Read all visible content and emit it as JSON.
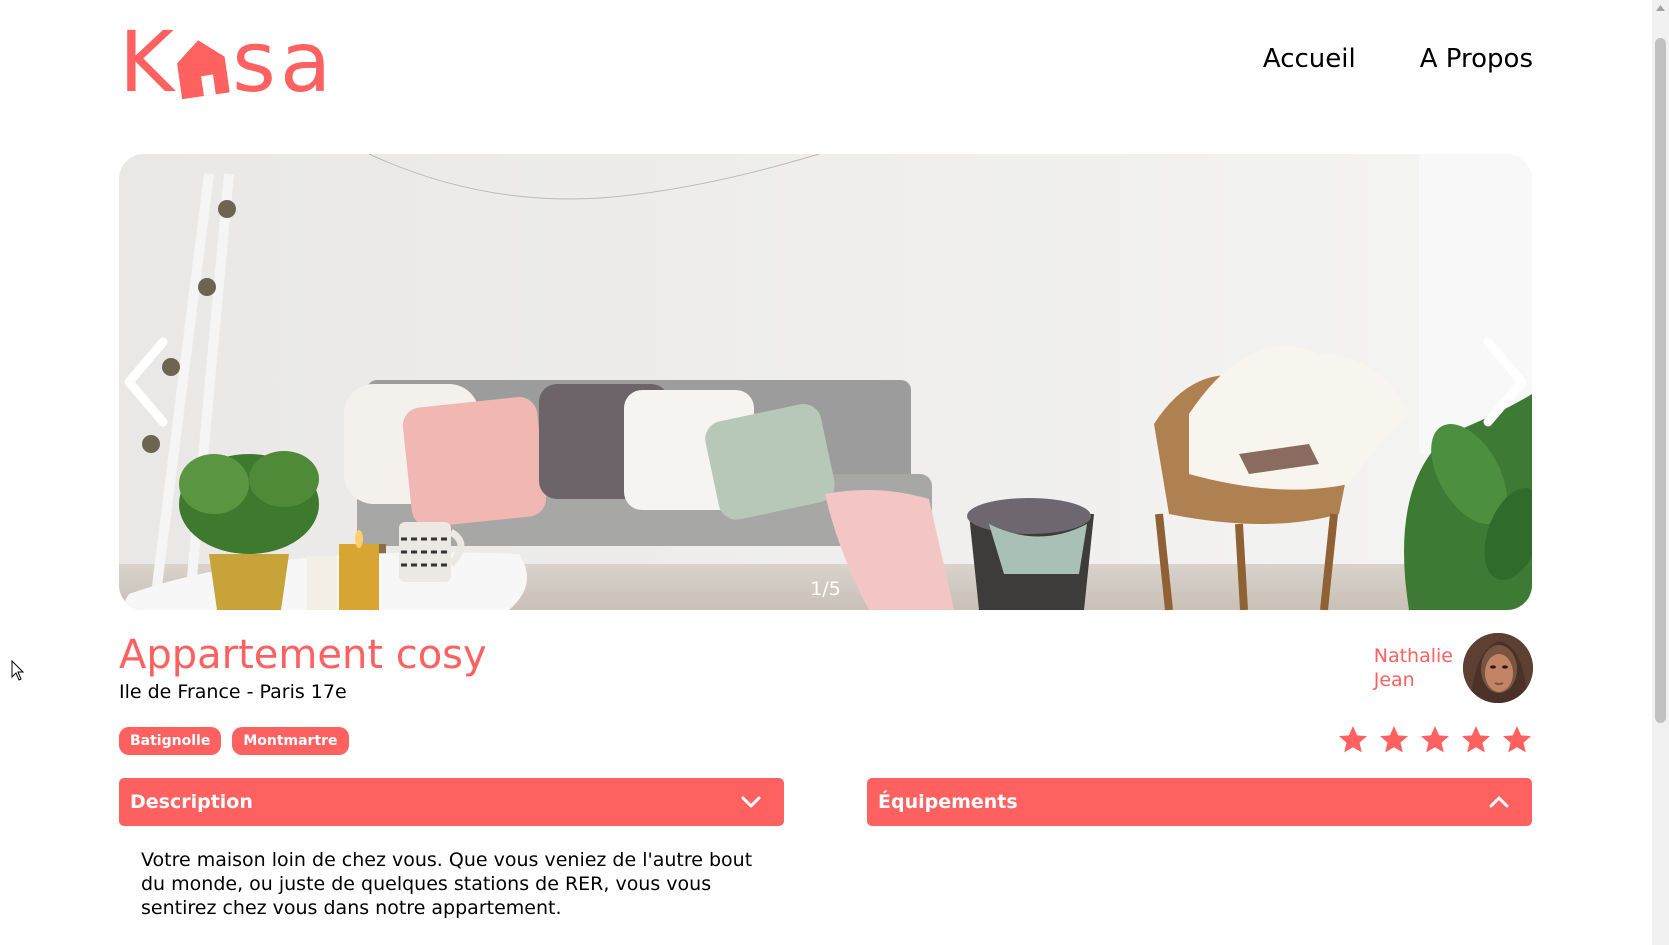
{
  "header": {
    "logo_text_k": "K",
    "logo_text_sa": "sa",
    "nav": [
      {
        "label": "Accueil"
      },
      {
        "label": "A Propos"
      }
    ]
  },
  "carousel": {
    "counter": "1/5",
    "prev_icon": "chevron-left-icon",
    "next_icon": "chevron-right-icon"
  },
  "listing": {
    "title": "Appartement cosy",
    "location": "Ile de France - Paris 17e",
    "tags": [
      "Batignolle",
      "Montmartre"
    ],
    "host": {
      "first_name": "Nathalie",
      "last_name": "Jean"
    },
    "rating": 5,
    "rating_max": 5
  },
  "collapses": {
    "description": {
      "title": "Description",
      "state": "open",
      "text": "Votre maison loin de chez vous. Que vous veniez de l'autre bout du monde, ou juste de quelques stations de RER, vous vous sentirez chez vous dans notre appartement."
    },
    "equipments": {
      "title": "Équipements",
      "state": "closed"
    }
  },
  "colors": {
    "brand": "#FF6060",
    "star_active": "#FF6060",
    "text": "#000000",
    "background": "#FFFFFF"
  }
}
